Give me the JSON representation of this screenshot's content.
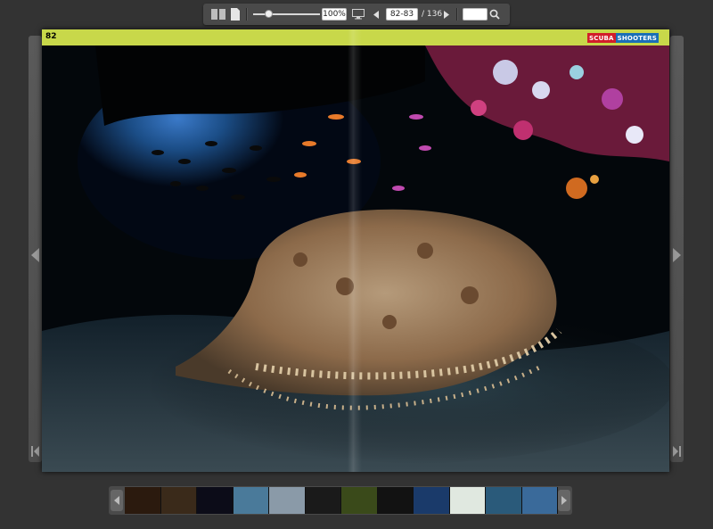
{
  "toolbar": {
    "zoom": "100%",
    "zoom_level": 0.2,
    "current_pages": "82-83",
    "total_pages": "/ 136",
    "search_value": ""
  },
  "page": {
    "number": "82",
    "logo_left": "SCUBA",
    "logo_right": "SHOOTERS",
    "band_color": "#c8d84a"
  },
  "thumbnails": [
    {
      "color": "#2b1a0e"
    },
    {
      "color": "#3a2a1a"
    },
    {
      "color": "#0c0c18"
    },
    {
      "color": "#4a7a9a"
    },
    {
      "color": "#8a9aa8"
    },
    {
      "color": "#1a1a1a"
    },
    {
      "color": "#3a4a1a"
    },
    {
      "color": "#121212"
    },
    {
      "color": "#1a3a6a"
    },
    {
      "color": "#e0e8e0"
    },
    {
      "color": "#2a5a7a"
    },
    {
      "color": "#3a6a9a"
    }
  ],
  "icons": [
    "two-page-icon",
    "single-page-icon",
    "monitor-icon",
    "prev-page-icon",
    "next-page-icon",
    "search-icon",
    "arrow-left-icon",
    "arrow-right-icon",
    "first-page-icon",
    "last-page-icon"
  ]
}
